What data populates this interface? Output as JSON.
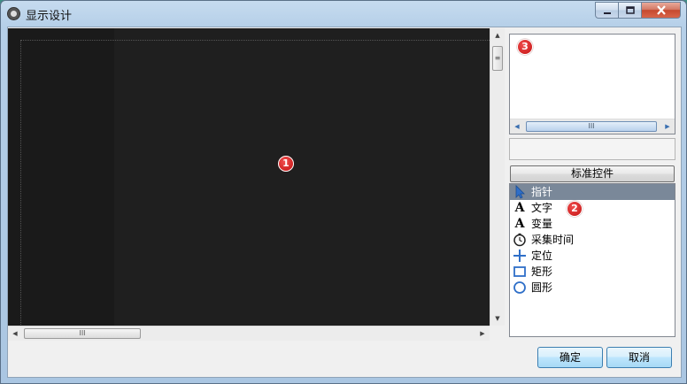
{
  "window": {
    "title": "显示设计",
    "app_icon": "camera-app-icon",
    "controls": {
      "minimize": "–",
      "maximize": "□",
      "close": "x"
    }
  },
  "canvas": {
    "badge": "1",
    "vscroll_grip": "≡",
    "hscroll_grip": "III"
  },
  "preview": {
    "badge": "3",
    "hscroll_grip": "III"
  },
  "toolbox": {
    "header_label": "标准控件",
    "badge": "2",
    "selected_index": 0,
    "items": [
      {
        "label": "指针",
        "icon": "pointer-arrow-icon"
      },
      {
        "label": "文字",
        "icon": "letter-a-icon"
      },
      {
        "label": "变量",
        "icon": "letter-a-icon"
      },
      {
        "label": "采集时间",
        "icon": "clock-icon"
      },
      {
        "label": "定位",
        "icon": "crosshair-icon"
      },
      {
        "label": "矩形",
        "icon": "rectangle-icon"
      },
      {
        "label": "圆形",
        "icon": "circle-icon"
      }
    ]
  },
  "buttons": {
    "ok": "确定",
    "cancel": "取消"
  },
  "colors": {
    "accent_blue": "#2f6fc8",
    "badge_red": "#d42020",
    "canvas_bg": "#1f1f1f"
  }
}
